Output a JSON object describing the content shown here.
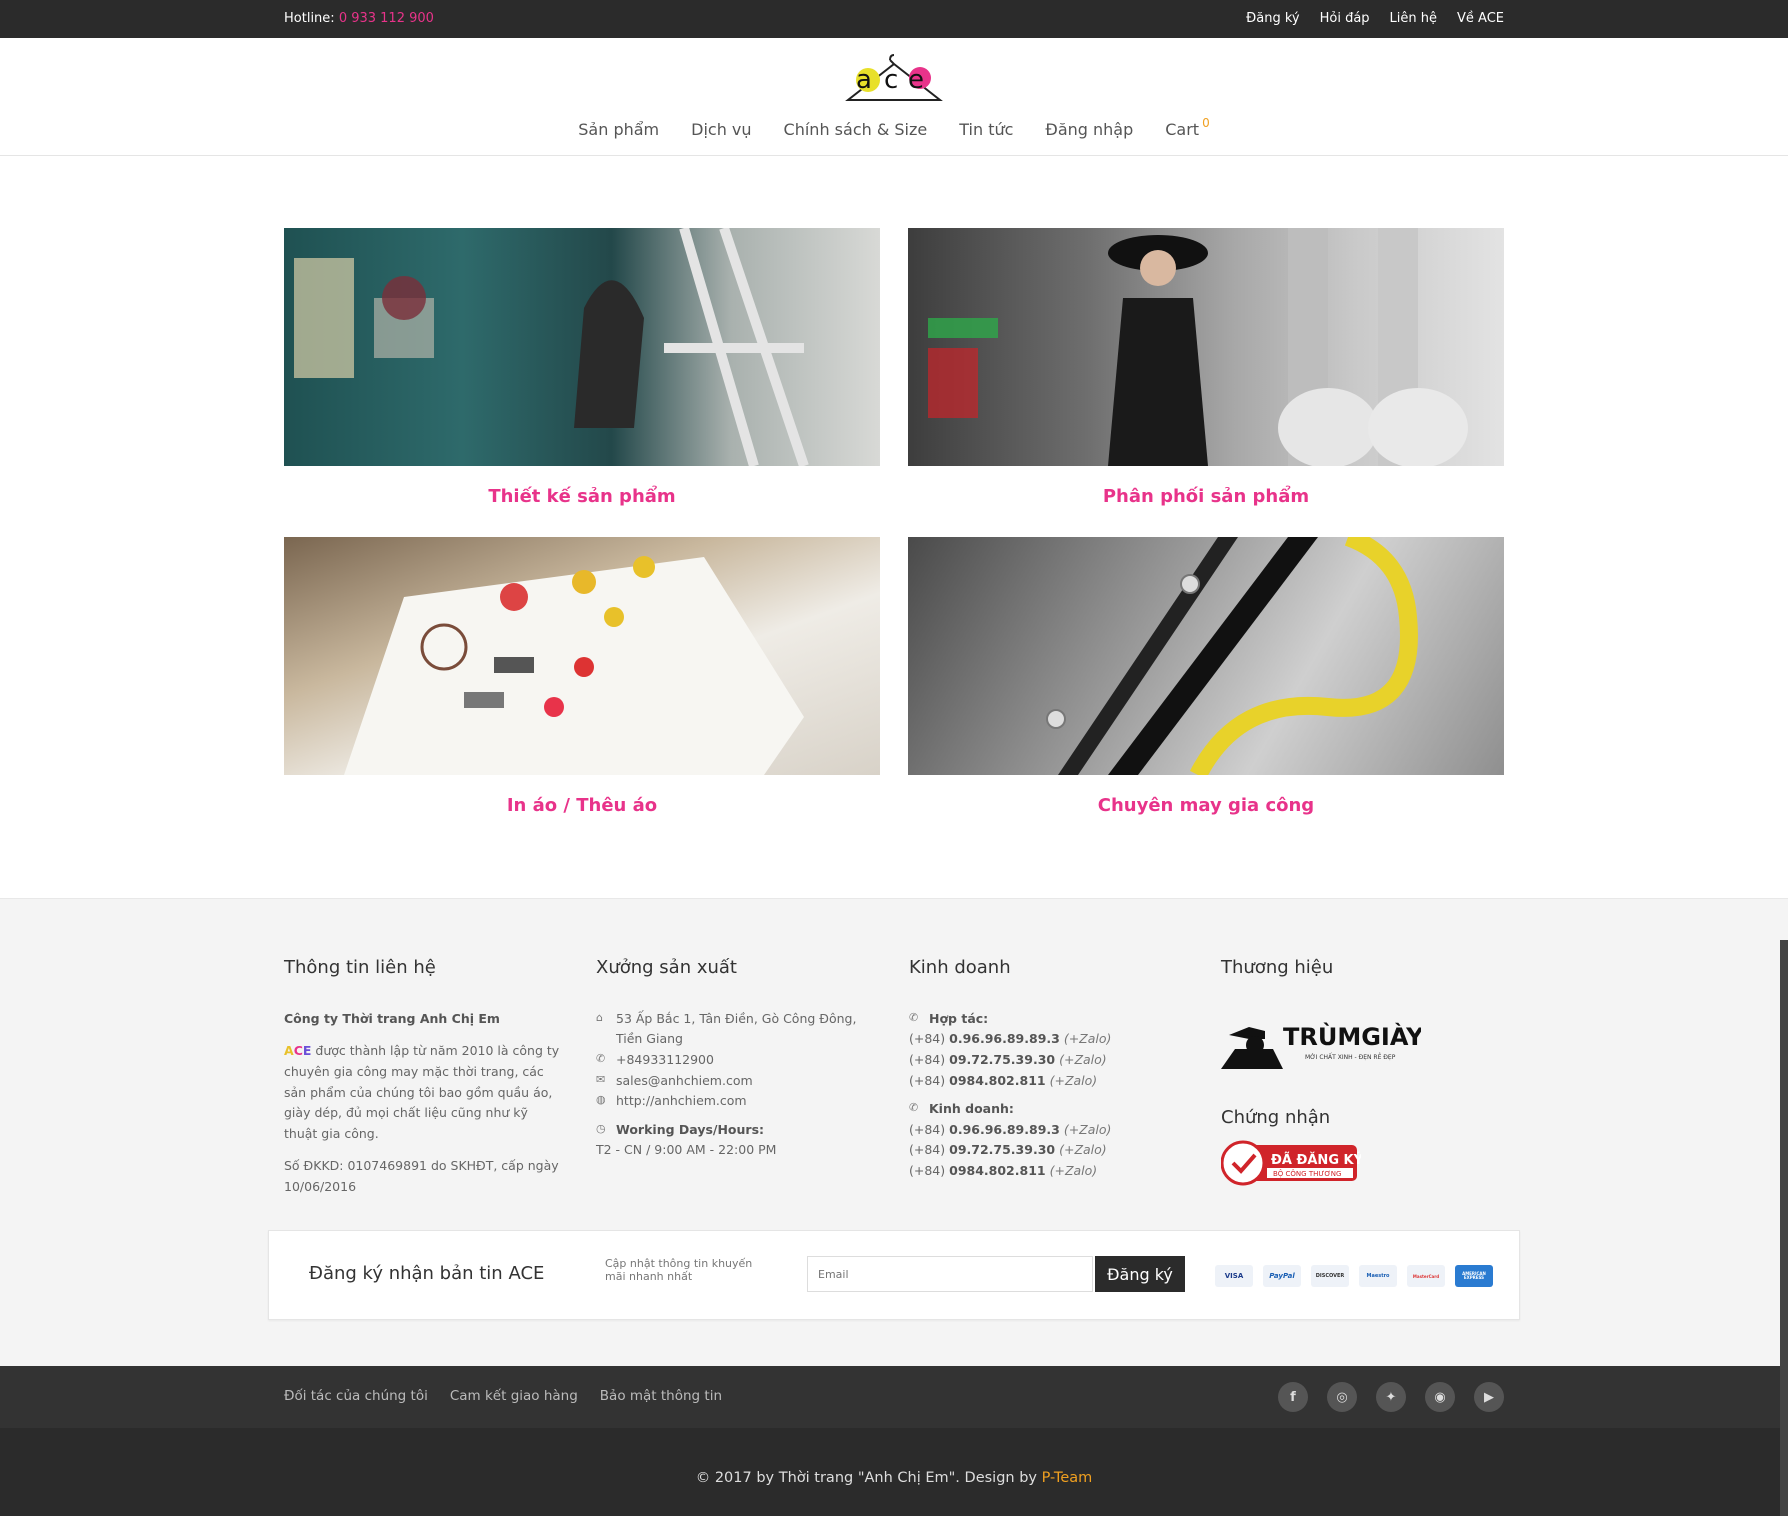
{
  "topbar": {
    "hotline_label": "Hotline:",
    "hotline_number": "0 933 112 900",
    "links": [
      "Đăng ký",
      "Hỏi đáp",
      "Liên hệ",
      "Về ACE"
    ]
  },
  "header": {
    "logo_alt": "ace",
    "nav": [
      "Sản phẩm",
      "Dịch vụ",
      "Chính sách & Size",
      "Tin tức",
      "Đăng nhập",
      "Cart"
    ],
    "cart_count": "0"
  },
  "services": [
    {
      "caption": "Thiết kế sản phẩm"
    },
    {
      "caption": "Phân phối sản phẩm"
    },
    {
      "caption": "In áo / Thêu áo"
    },
    {
      "caption": "Chuyên may gia công"
    }
  ],
  "footer": {
    "contact": {
      "title": "Thông tin liên hệ",
      "company": "Công ty Thời trang Anh Chị Em",
      "desc": "được thành lập từ năm 2010 là công ty chuyên gia công may mặc thời trang, các sản phẩm của chúng tôi bao gồm quầu áo, giày dép, đủ mọi chất liệu cũng như kỹ thuật gia công.",
      "license": "Số ĐKKD: 0107469891 do SKHĐT, cấp ngày 10/06/2016"
    },
    "factory": {
      "title": "Xưởng sản xuất",
      "address": "53 Ấp Bắc 1, Tân Điền, Gò Công Đông, Tiền Giang",
      "phone": "+84933112900",
      "email": "sales@anhchiem.com",
      "website": "http://anhchiem.com",
      "hours_label": "Working Days/Hours:",
      "hours": "T2 - CN / 9:00 AM - 22:00 PM"
    },
    "business": {
      "title": "Kinh doanh",
      "coop_label": "Hợp tác:",
      "coop_phones": [
        {
          "prefix": "(+84)",
          "num": "0.96.96.89.89.3",
          "note": "(+Zalo)"
        },
        {
          "prefix": "(+84)",
          "num": "09.72.75.39.30",
          "note": "(+Zalo)"
        },
        {
          "prefix": "(+84)",
          "num": "0984.802.811",
          "note": "(+Zalo)"
        }
      ],
      "sales_label": "Kinh doanh:",
      "sales_phones": [
        {
          "prefix": "(+84)",
          "num": "0.96.96.89.89.3",
          "note": "(+Zalo)"
        },
        {
          "prefix": "(+84)",
          "num": "09.72.75.39.30",
          "note": "(+Zalo)"
        },
        {
          "prefix": "(+84)",
          "num": "0984.802.811",
          "note": "(+Zalo)"
        }
      ]
    },
    "brand": {
      "title": "Thương hiệu",
      "logo_text": "TRÙMGIÀY",
      "logo_sub": "MỚI CHẤT XINH - ĐẸN RẺ ĐẸP",
      "cert_title": "Chứng nhận",
      "cert_text": "ĐÃ ĐĂNG KÝ",
      "cert_sub": "BỘ CÔNG THƯƠNG"
    }
  },
  "newsletter": {
    "title": "Đăng ký nhận bản tin ACE",
    "subtitle": "Cập nhật thông tin khuyến mãi nhanh nhất",
    "placeholder": "Email",
    "button": "Đăng ký",
    "cards": [
      "VISA",
      "PayPal",
      "DISCOVER",
      "Maestro",
      "MasterCard",
      "AMERICAN EXPRESS"
    ]
  },
  "bottom": {
    "links": [
      "Đối tác của chúng tôi",
      "Cam kết giao hàng",
      "Bảo mật thông tin"
    ],
    "social": [
      "facebook-icon",
      "instagram-icon",
      "twitter-icon",
      "rss-icon",
      "youtube-icon"
    ]
  },
  "copyright": {
    "text": "© 2017 by Thời trang \"Anh Chị Em\". Design by",
    "designer": "P-Team"
  }
}
